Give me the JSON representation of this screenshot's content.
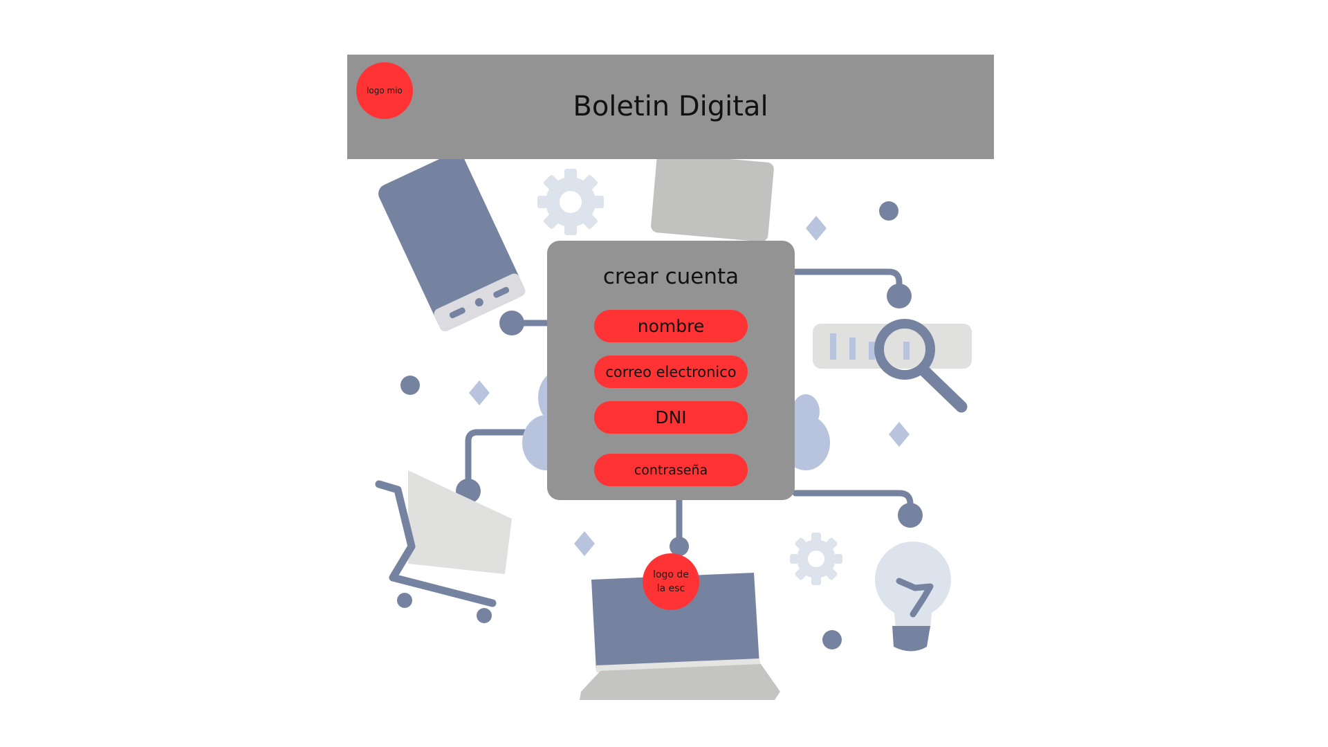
{
  "header": {
    "title": "Boletin Digital",
    "logo_label": "logo mio"
  },
  "form": {
    "title": "crear cuenta",
    "fields": [
      {
        "label": "nombre"
      },
      {
        "label": "correo electronico"
      },
      {
        "label": "DNI"
      },
      {
        "label": "contraseña"
      }
    ]
  },
  "school_logo": {
    "label_line1": "logo de",
    "label_line2": "la esc"
  },
  "colors": {
    "header_bg": "#939393",
    "card_bg": "#939393",
    "accent_red": "#ff3333",
    "illustration_blue": "#7683a0",
    "illustration_light": "#b8c4de",
    "illustration_grey": "#c1c1bf"
  },
  "icons": [
    "phone-icon",
    "gear-icon",
    "folder-icon",
    "search-icon",
    "cart-icon",
    "laptop-icon",
    "lightbulb-icon",
    "cloud-icon"
  ]
}
